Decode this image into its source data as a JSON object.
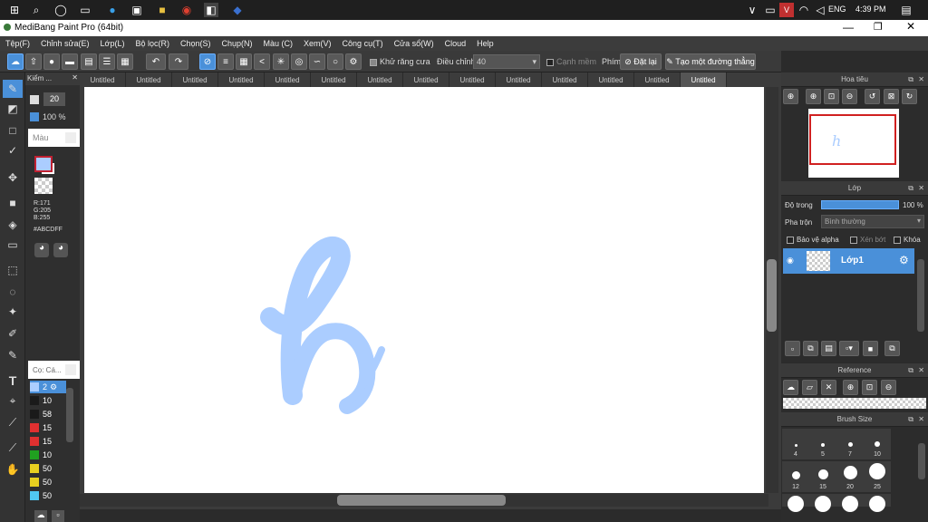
{
  "taskbar": {
    "time": "4:39 PM",
    "language": "ENG"
  },
  "window": {
    "title": "MediBang Paint Pro (64bit)"
  },
  "menu": [
    "Tệp(F)",
    "Chỉnh sửa(E)",
    "Lớp(L)",
    "Bộ lọc(R)",
    "Chọn(S)",
    "Chụp(N)",
    "Màu (C)",
    "Xem(V)",
    "Công cụ(T)",
    "Cửa sổ(W)",
    "Cloud",
    "Help"
  ],
  "toolbar": {
    "antialias_label": "Khử răng cưa",
    "correction_label": "Điều chỉnh",
    "correction_value": "40",
    "canh_mem_label": "Cạnh mềm",
    "phim_label": "Phím",
    "reset_label": "Đặt lại",
    "line_label": "Tạo một đường thẳng"
  },
  "tabs": [
    "Untitled",
    "Untitled",
    "Untitled",
    "Untitled",
    "Untitled",
    "Untitled",
    "Untitled",
    "Untitled",
    "Untitled",
    "Untitled",
    "Untitled",
    "Untitled",
    "Untitled",
    "Untitled"
  ],
  "brush_settings": {
    "panel_label": "Kiểm ...",
    "size": "20",
    "opacity": "100 %"
  },
  "color_panel": {
    "label": "Màu",
    "r": "R:171",
    "g": "G:205",
    "b": "B:255",
    "hex": "#ABCDFF",
    "primary": "#ABCDFF",
    "secondary": "#ffffff"
  },
  "brush_list": {
    "label": "Cọ: Cá...",
    "items": [
      {
        "size": "2",
        "color": "#ABCDFF"
      },
      {
        "size": "10",
        "color": "#1a1a1a"
      },
      {
        "size": "58",
        "color": "#1a1a1a"
      },
      {
        "size": "15",
        "color": "#e03030"
      },
      {
        "size": "15",
        "color": "#e03030"
      },
      {
        "size": "10",
        "color": "#20a020"
      },
      {
        "size": "50",
        "color": "#e8d020"
      },
      {
        "size": "50",
        "color": "#e8d020"
      },
      {
        "size": "50",
        "color": "#50c8f0"
      }
    ]
  },
  "canvas": {
    "stroke_color": "#ABCDFF"
  },
  "navigator": {
    "title": "Hoa tiêu"
  },
  "layer_panel": {
    "title": "Lớp",
    "opacity_label": "Độ trong",
    "opacity_value": "100 %",
    "blend_label": "Pha trộn",
    "blend_value": "Bình thường",
    "protect_alpha": "Bảo vệ alpha",
    "clipping": "Xén bớt",
    "lock": "Khóa",
    "layer_name": "Lớp1"
  },
  "reference_panel": {
    "title": "Reference"
  },
  "brush_size_panel": {
    "title": "Brush Size",
    "sizes": [
      "4",
      "5",
      "7",
      "10",
      "12",
      "15",
      "20",
      "25"
    ]
  }
}
